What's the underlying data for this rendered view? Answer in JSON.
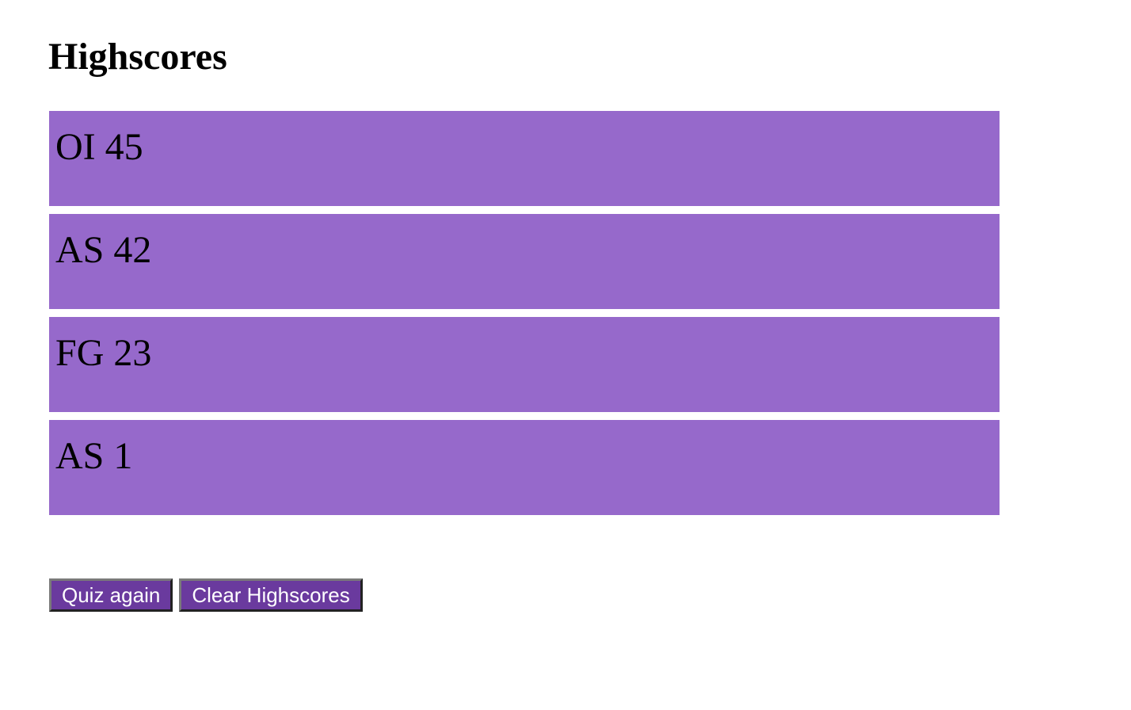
{
  "page": {
    "title": "Highscores"
  },
  "highscores": [
    "OI 45",
    "AS 42",
    "FG 23",
    "AS 1"
  ],
  "buttons": {
    "quiz_again": "Quiz again",
    "clear_highscores": "Clear Highscores"
  },
  "colors": {
    "score_item_bg": "#9669CB",
    "button_bg": "#6A3A9E",
    "text": "#000000",
    "button_text": "#FFFFFF"
  }
}
